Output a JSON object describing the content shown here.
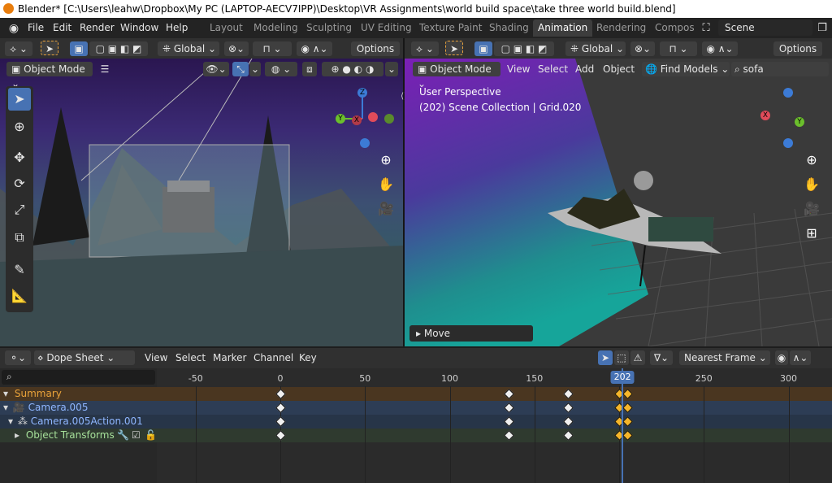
{
  "window": {
    "title": "Blender* [C:\\Users\\leahw\\Dropbox\\My PC (LAPTOP-AECV7IPP)\\Desktop\\VR Assignments\\world build space\\take three world build.blend]"
  },
  "menu": {
    "items": [
      "File",
      "Edit",
      "Render",
      "Window",
      "Help"
    ]
  },
  "workspaces": {
    "tabs": [
      "Layout",
      "Modeling",
      "Sculpting",
      "UV Editing",
      "Texture Paint",
      "Shading",
      "Animation",
      "Rendering",
      "Compos"
    ],
    "active": "Animation"
  },
  "scene": {
    "name": "Scene"
  },
  "left_view": {
    "transform_orientation": "Global",
    "options_label": "Options",
    "mode": "Object Mode"
  },
  "right_view": {
    "transform_orientation": "Global",
    "options_label": "Options",
    "mode": "Object Mode",
    "menus": [
      "View",
      "Select",
      "Add",
      "Object"
    ],
    "find_models": "Find Models",
    "search_value": "sofa",
    "perspective_label": "User Perspective",
    "collection_label": "(202) Scene Collection | Grid.020",
    "last_op": "Move"
  },
  "gizmo": {
    "x": "X",
    "y": "Y",
    "z": "Z"
  },
  "dope_sheet": {
    "editor_mode": "Dope Sheet",
    "menus": [
      "View",
      "Select",
      "Marker",
      "Channel",
      "Key"
    ],
    "snap": "Nearest Frame",
    "current_frame": "202",
    "frame_ticks": [
      -50,
      0,
      50,
      100,
      150,
      200,
      250,
      300
    ],
    "channels": [
      {
        "label": "Summary",
        "color": "#e9a23a"
      },
      {
        "label": "Camera.005",
        "color": "#8fb6ff"
      },
      {
        "label": "Camera.005Action.001",
        "color": "#8fb6ff"
      },
      {
        "label": "Object Transforms",
        "color": "#a6e09a"
      }
    ],
    "keyframes": [
      0,
      135,
      170,
      200,
      205
    ]
  },
  "colors": {
    "accent": "#4772b3",
    "summary_row": "#4a3620",
    "object_row": "#2d3d55",
    "transform_row": "#2f3a2f",
    "playhead": "#4772b3"
  }
}
